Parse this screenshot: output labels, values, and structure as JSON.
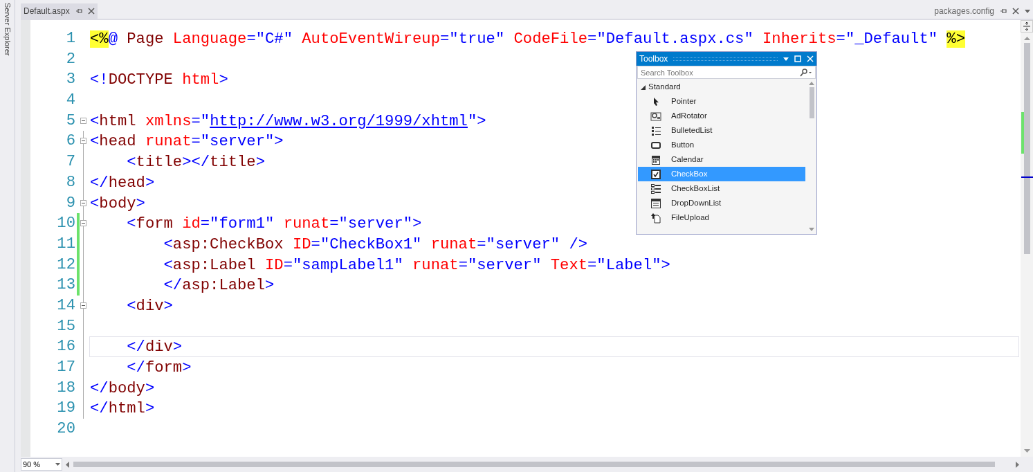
{
  "side_panel": {
    "label": "Server Explorer"
  },
  "tabs": [
    {
      "label": "Default.aspx",
      "selected": true
    },
    {
      "label": "packages.config",
      "selected": false
    }
  ],
  "editor": {
    "lines": [
      {
        "number": "1",
        "changed": false,
        "collapsible": false,
        "in_block": false,
        "current": false,
        "tokens": [
          {
            "kind": "directive",
            "text": "<%"
          },
          {
            "kind": "tag",
            "text": "@"
          },
          {
            "kind": "el",
            "text": " Page"
          },
          {
            "kind": "attr",
            "text": " Language"
          },
          {
            "kind": "tag",
            "text": "=\"C#\""
          },
          {
            "kind": "attr",
            "text": " AutoEventWireup"
          },
          {
            "kind": "tag",
            "text": "=\"true\""
          },
          {
            "kind": "attr",
            "text": " CodeFile"
          },
          {
            "kind": "tag",
            "text": "=\"Default.aspx.cs\""
          },
          {
            "kind": "attr",
            "text": " Inherits"
          },
          {
            "kind": "tag",
            "text": "=\"_Default\" "
          },
          {
            "kind": "directive",
            "text": "%>"
          }
        ]
      },
      {
        "number": "2",
        "changed": false,
        "collapsible": false,
        "in_block": false,
        "current": false
      },
      {
        "number": "3",
        "changed": false,
        "collapsible": false,
        "in_block": false,
        "current": false,
        "tokens": [
          {
            "kind": "tag",
            "text": "<!"
          },
          {
            "kind": "el",
            "text": "DOCTYPE"
          },
          {
            "kind": "attr",
            "text": " html"
          },
          {
            "kind": "tag",
            "text": ">"
          }
        ]
      },
      {
        "number": "4",
        "changed": false,
        "collapsible": false,
        "in_block": false,
        "current": false
      },
      {
        "number": "5",
        "changed": false,
        "collapsible": true,
        "in_block": false,
        "current": false,
        "tokens": [
          {
            "kind": "tag",
            "text": "<"
          },
          {
            "kind": "el",
            "text": "html"
          },
          {
            "kind": "attr",
            "text": " xmlns"
          },
          {
            "kind": "tag",
            "text": "=\""
          },
          {
            "kind": "link",
            "text": "http://www.w3.org/1999/xhtml"
          },
          {
            "kind": "tag",
            "text": "\">"
          }
        ]
      },
      {
        "number": "6",
        "changed": false,
        "collapsible": true,
        "in_block": true,
        "current": false,
        "tokens": [
          {
            "kind": "tag",
            "text": "<"
          },
          {
            "kind": "el",
            "text": "head"
          },
          {
            "kind": "attr",
            "text": " runat"
          },
          {
            "kind": "tag",
            "text": "=\"server\">"
          }
        ]
      },
      {
        "number": "7",
        "changed": false,
        "collapsible": false,
        "in_block": true,
        "current": false,
        "tokens": [
          {
            "kind": "tag",
            "text": "    <"
          },
          {
            "kind": "el",
            "text": "title"
          },
          {
            "kind": "tag",
            "text": "></"
          },
          {
            "kind": "el",
            "text": "title"
          },
          {
            "kind": "tag",
            "text": ">"
          }
        ]
      },
      {
        "number": "8",
        "changed": false,
        "collapsible": false,
        "in_block": true,
        "current": false,
        "tokens": [
          {
            "kind": "tag",
            "text": "</"
          },
          {
            "kind": "el",
            "text": "head"
          },
          {
            "kind": "tag",
            "text": ">"
          }
        ]
      },
      {
        "number": "9",
        "changed": false,
        "collapsible": true,
        "in_block": true,
        "current": false,
        "tokens": [
          {
            "kind": "tag",
            "text": "<"
          },
          {
            "kind": "el",
            "text": "body"
          },
          {
            "kind": "tag",
            "text": ">"
          }
        ]
      },
      {
        "number": "10",
        "changed": true,
        "collapsible": true,
        "in_block": true,
        "current": false,
        "tokens": [
          {
            "kind": "tag",
            "text": "    <"
          },
          {
            "kind": "el",
            "text": "form"
          },
          {
            "kind": "attr",
            "text": " id"
          },
          {
            "kind": "tag",
            "text": "=\"form1\""
          },
          {
            "kind": "attr",
            "text": " runat"
          },
          {
            "kind": "tag",
            "text": "=\"server\">"
          }
        ]
      },
      {
        "number": "11",
        "changed": true,
        "collapsible": false,
        "in_block": true,
        "current": false,
        "tokens": [
          {
            "kind": "tag",
            "text": "        <"
          },
          {
            "kind": "el",
            "text": "asp:CheckBox"
          },
          {
            "kind": "attr",
            "text": " ID"
          },
          {
            "kind": "tag",
            "text": "=\"CheckBox1\""
          },
          {
            "kind": "attr",
            "text": " runat"
          },
          {
            "kind": "tag",
            "text": "=\"server\" />"
          }
        ]
      },
      {
        "number": "12",
        "changed": true,
        "collapsible": false,
        "in_block": true,
        "current": false,
        "tokens": [
          {
            "kind": "tag",
            "text": "        <"
          },
          {
            "kind": "el",
            "text": "asp:Label"
          },
          {
            "kind": "attr",
            "text": " ID"
          },
          {
            "kind": "tag",
            "text": "=\"sampLabel1\""
          },
          {
            "kind": "attr",
            "text": " runat"
          },
          {
            "kind": "tag",
            "text": "=\"server\""
          },
          {
            "kind": "attr",
            "text": " Text"
          },
          {
            "kind": "tag",
            "text": "=\"Label\">"
          }
        ]
      },
      {
        "number": "13",
        "changed": true,
        "collapsible": false,
        "in_block": true,
        "current": false,
        "tokens": [
          {
            "kind": "tag",
            "text": "        </"
          },
          {
            "kind": "el",
            "text": "asp:Label"
          },
          {
            "kind": "tag",
            "text": ">"
          }
        ]
      },
      {
        "number": "14",
        "changed": false,
        "collapsible": true,
        "in_block": true,
        "current": false,
        "tokens": [
          {
            "kind": "tag",
            "text": "    <"
          },
          {
            "kind": "el",
            "text": "div"
          },
          {
            "kind": "tag",
            "text": ">"
          }
        ]
      },
      {
        "number": "15",
        "changed": false,
        "collapsible": false,
        "in_block": true,
        "current": false
      },
      {
        "number": "16",
        "changed": false,
        "collapsible": false,
        "in_block": true,
        "current": true,
        "tokens": [
          {
            "kind": "tag",
            "text": "    </"
          },
          {
            "kind": "el",
            "text": "div"
          },
          {
            "kind": "tag",
            "text": ">"
          }
        ]
      },
      {
        "number": "17",
        "changed": false,
        "collapsible": false,
        "in_block": true,
        "current": false,
        "tokens": [
          {
            "kind": "tag",
            "text": "    </"
          },
          {
            "kind": "el",
            "text": "form"
          },
          {
            "kind": "tag",
            "text": ">"
          }
        ]
      },
      {
        "number": "18",
        "changed": false,
        "collapsible": false,
        "in_block": true,
        "current": false,
        "tokens": [
          {
            "kind": "tag",
            "text": "</"
          },
          {
            "kind": "el",
            "text": "body"
          },
          {
            "kind": "tag",
            "text": ">"
          }
        ]
      },
      {
        "number": "19",
        "changed": false,
        "collapsible": false,
        "in_block": true,
        "current": false,
        "tokens": [
          {
            "kind": "tag",
            "text": "</"
          },
          {
            "kind": "el",
            "text": "html"
          },
          {
            "kind": "tag",
            "text": ">"
          }
        ]
      },
      {
        "number": "20",
        "changed": false,
        "collapsible": false,
        "in_block": false,
        "current": false
      }
    ],
    "zoom": "90 %"
  },
  "toolbox": {
    "title": "Toolbox",
    "search": {
      "placeholder": "Search Toolbox"
    },
    "group": {
      "label": "Standard",
      "expanded": true
    },
    "items": [
      {
        "label": "Pointer",
        "kind": "pointer",
        "selected": false
      },
      {
        "label": "AdRotator",
        "kind": "rotator",
        "selected": false
      },
      {
        "label": "BulletedList",
        "kind": "bullets",
        "selected": false
      },
      {
        "label": "Button",
        "kind": "button",
        "selected": false
      },
      {
        "label": "Calendar",
        "kind": "calendar",
        "selected": false
      },
      {
        "label": "CheckBox",
        "kind": "checkbox",
        "selected": true
      },
      {
        "label": "CheckBoxList",
        "kind": "checklist",
        "selected": false
      },
      {
        "label": "DropDownList",
        "kind": "dropdown",
        "selected": false
      },
      {
        "label": "FileUpload",
        "kind": "upload",
        "selected": false
      }
    ]
  }
}
